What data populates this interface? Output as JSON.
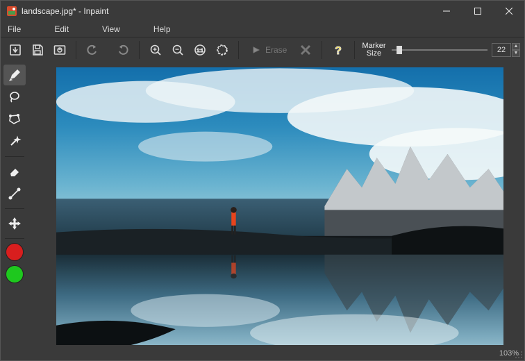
{
  "titlebar": {
    "title": "landscape.jpg* - Inpaint"
  },
  "menu": {
    "file": "File",
    "edit": "Edit",
    "view": "View",
    "help": "Help"
  },
  "toolbar": {
    "erase_label": "Erase",
    "marker_label_l1": "Marker",
    "marker_label_l2": "Size",
    "marker_value": "22"
  },
  "colors": {
    "red": "#d81e1e",
    "green": "#1ec81e",
    "help_yellow": "#ffdf1e"
  },
  "status": {
    "zoom": "103%"
  },
  "slider": {
    "percent": 5
  }
}
